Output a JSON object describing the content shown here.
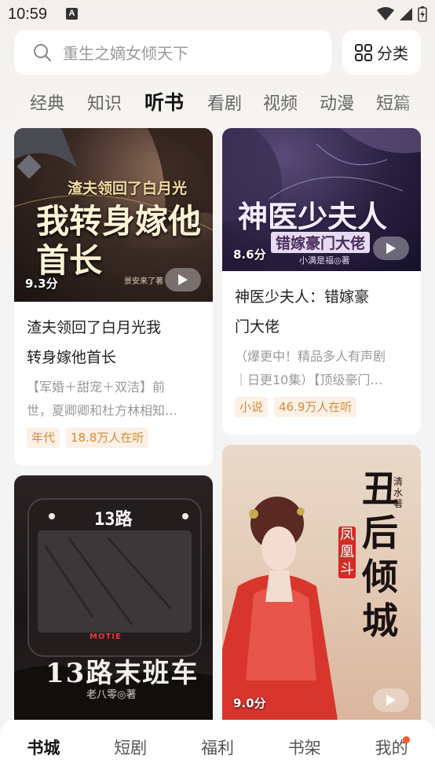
{
  "status_bar": {
    "time": "10:59",
    "notification_letter": "A"
  },
  "search": {
    "placeholder": "重生之嫡女倾天下",
    "category_label": "分类"
  },
  "tabs": [
    {
      "label": "经典"
    },
    {
      "label": "知识"
    },
    {
      "label": "听书",
      "active": true
    },
    {
      "label": "看剧"
    },
    {
      "label": "视频"
    },
    {
      "label": "动漫"
    },
    {
      "label": "短篇"
    }
  ],
  "books": [
    {
      "cover_title_top": "渣夫领回了白月光",
      "cover_title_main": "我转身嫁他首长",
      "cover_author": "景安来了著",
      "score": "9.3分",
      "title_line1": "渣夫领回了白月光我",
      "title_line2": "转身嫁他首长",
      "desc_line1": "【军婚＋甜宠＋双洁】前",
      "desc_line2": "世，夏卿卿和杜方林相知…",
      "tag": "年代",
      "listeners": "18.8万人在听"
    },
    {
      "cover_title_main": "神医少夫人",
      "cover_title_sub": "错嫁豪门大佬",
      "cover_author": "小满是福◎著",
      "score": "8.6分",
      "title_line1": "神医少夫人：错嫁豪",
      "title_line2": "门大佬",
      "desc_line1": "（爆更中！精品多人有声剧",
      "desc_line2": "｜日更10集）【顶级豪门…",
      "tag": "小说",
      "listeners": "46.9万人在听"
    },
    {
      "cover_bus": "13路",
      "cover_brand": "MOTIE",
      "cover_title_main": "13路末班车",
      "cover_author": "老八零◎著"
    },
    {
      "cover_title_main": "丑后倾城",
      "cover_title_sub": "凤凰斗",
      "cover_author": "清水著",
      "score": "9.0分"
    }
  ],
  "bottom_nav": [
    {
      "label": "书城",
      "active": true
    },
    {
      "label": "短剧"
    },
    {
      "label": "福利"
    },
    {
      "label": "书架"
    },
    {
      "label": "我的",
      "badge": true
    }
  ],
  "colors": {
    "tag_bg": "#fbf1e6",
    "tag_text": "#d98a3a",
    "badge": "#f25a2a"
  }
}
